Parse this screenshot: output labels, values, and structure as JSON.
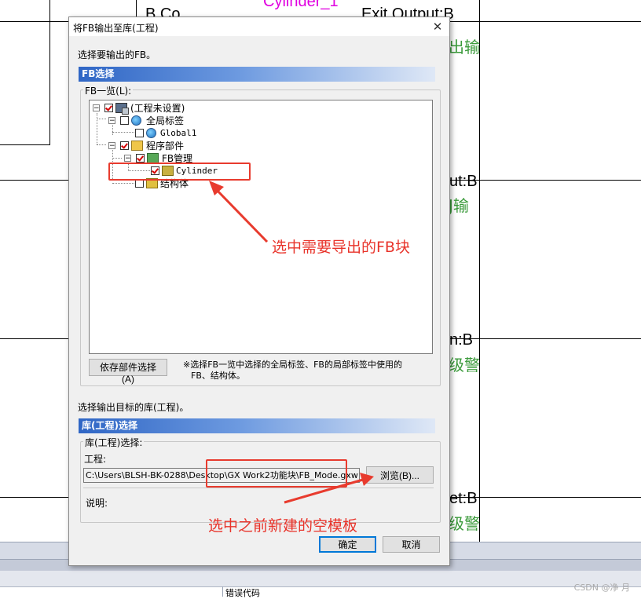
{
  "background": {
    "fragments_black": [
      "ut:B",
      "ut:B",
      "n:B",
      "et:B"
    ],
    "fragments_green": [
      "出输",
      "J输",
      "级警",
      "级警"
    ],
    "top_magenta": "Cylinder_1",
    "top_black": "B Co",
    "top_black2": "Exit Output:B",
    "error_code_label": "错误代码"
  },
  "dialog": {
    "title": "将FB输出至库(工程)",
    "close_glyph": "✕",
    "instruction_select_fb": "选择要输出的FB。",
    "fb_section_title": "FB选择",
    "fb_list_label": "FB一览(L):",
    "tree": {
      "root": "(工程未设置)",
      "global_labels": "全局标签",
      "global1": "Global1",
      "program_parts": "程序部件",
      "fb_management": "FB管理",
      "cylinder": "Cylinder",
      "structures": "结构体"
    },
    "dependency_button": "依存部件选择(A)",
    "note_line1": "※选择FB一览中选择的全局标签、FB的局部标签中使用的",
    "note_line2": "FB、结构体。",
    "instruction_select_target": "选择输出目标的库(工程)。",
    "lib_section_title": "库(工程)选择",
    "lib_group_label": "库(工程)选择:",
    "project_label": "工程:",
    "project_path": "C:\\Users\\BLSH-BK-0288\\Desktop\\GX Work2功能块\\FB_Mode.gxw",
    "browse_button": "浏览(B)...",
    "description_label": "说明:",
    "ok_button": "确定",
    "cancel_button": "取消"
  },
  "annotations": {
    "fb_note": "选中需要导出的FB块",
    "template_note": "选中之前新建的空模板"
  },
  "watermark": "CSDN @净 月",
  "colors": {
    "annotation_red": "#e8332a",
    "section_blue": "#2f66c5",
    "ladder_green": "#3a9a3a",
    "label_magenta": "#e000e0"
  }
}
